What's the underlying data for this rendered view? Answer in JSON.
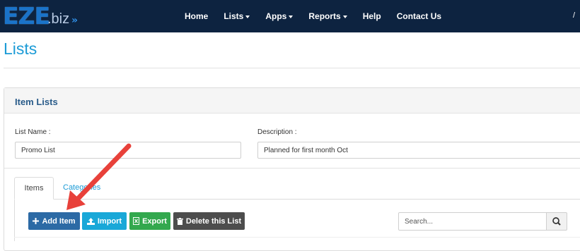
{
  "navbar": {
    "logo_main": "EZE",
    "logo_suffix": ".biz",
    "logo_chevrons": "»",
    "items": [
      {
        "label": "Home",
        "caret": false
      },
      {
        "label": "Lists",
        "caret": true
      },
      {
        "label": "Apps",
        "caret": true
      },
      {
        "label": "Reports",
        "caret": true
      },
      {
        "label": "Help",
        "caret": false
      },
      {
        "label": "Contact Us",
        "caret": false
      }
    ],
    "trailing": "/"
  },
  "page": {
    "title": "Lists"
  },
  "panel": {
    "heading": "Item Lists",
    "list_name_label": "List Name :",
    "list_name_value": "Promo List",
    "description_label": "Description :",
    "description_value": "Planned for first month Oct"
  },
  "tabs": [
    {
      "label": "Items",
      "active": true
    },
    {
      "label": "Categories",
      "active": false
    }
  ],
  "toolbar": {
    "add_label": "Add Item",
    "import_label": "Import",
    "export_label": "Export",
    "delete_label": "Delete this List",
    "search_placeholder": "Search..."
  },
  "icons": {
    "add": "plus-icon",
    "import": "upload-icon",
    "export": "excel-file-icon",
    "delete": "trash-icon",
    "search": "magnifier-icon"
  },
  "colors": {
    "navbar": "#0d2340",
    "title": "#1c9bd6",
    "add_button": "#2c6aa5",
    "import_button": "#19a8d8",
    "export_button": "#33a84e",
    "delete_button": "#4d4d4d",
    "annotation_arrow": "#e8413a"
  }
}
